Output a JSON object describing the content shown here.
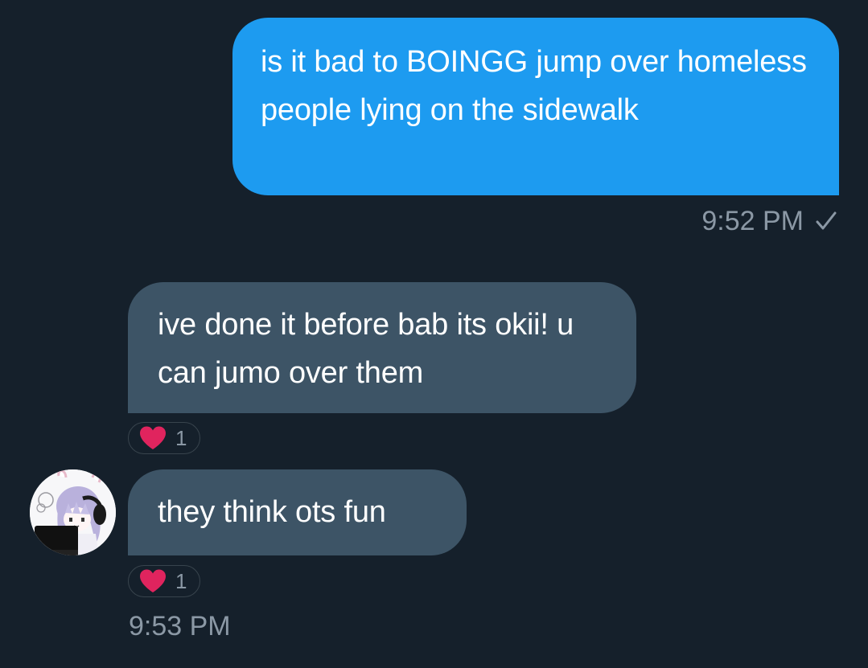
{
  "messages": {
    "sent": {
      "text": "is it bad to BOINGG jump over homeless people lying on the sidewalk",
      "time": "9:52 PM",
      "status_icon": "check-icon"
    },
    "received": [
      {
        "text": "ive done it before bab its okii! u can jumo over them",
        "reaction": {
          "icon": "heart-icon",
          "count": "1"
        }
      },
      {
        "text": "they think ots fun",
        "reaction": {
          "icon": "heart-icon",
          "count": "1"
        }
      }
    ],
    "received_time": "9:53 PM"
  },
  "colors": {
    "background": "#15202b",
    "sent_bubble": "#1d9bf0",
    "received_bubble": "#3d5466",
    "timestamp": "#8b98a5",
    "heart": "#e0245e"
  }
}
